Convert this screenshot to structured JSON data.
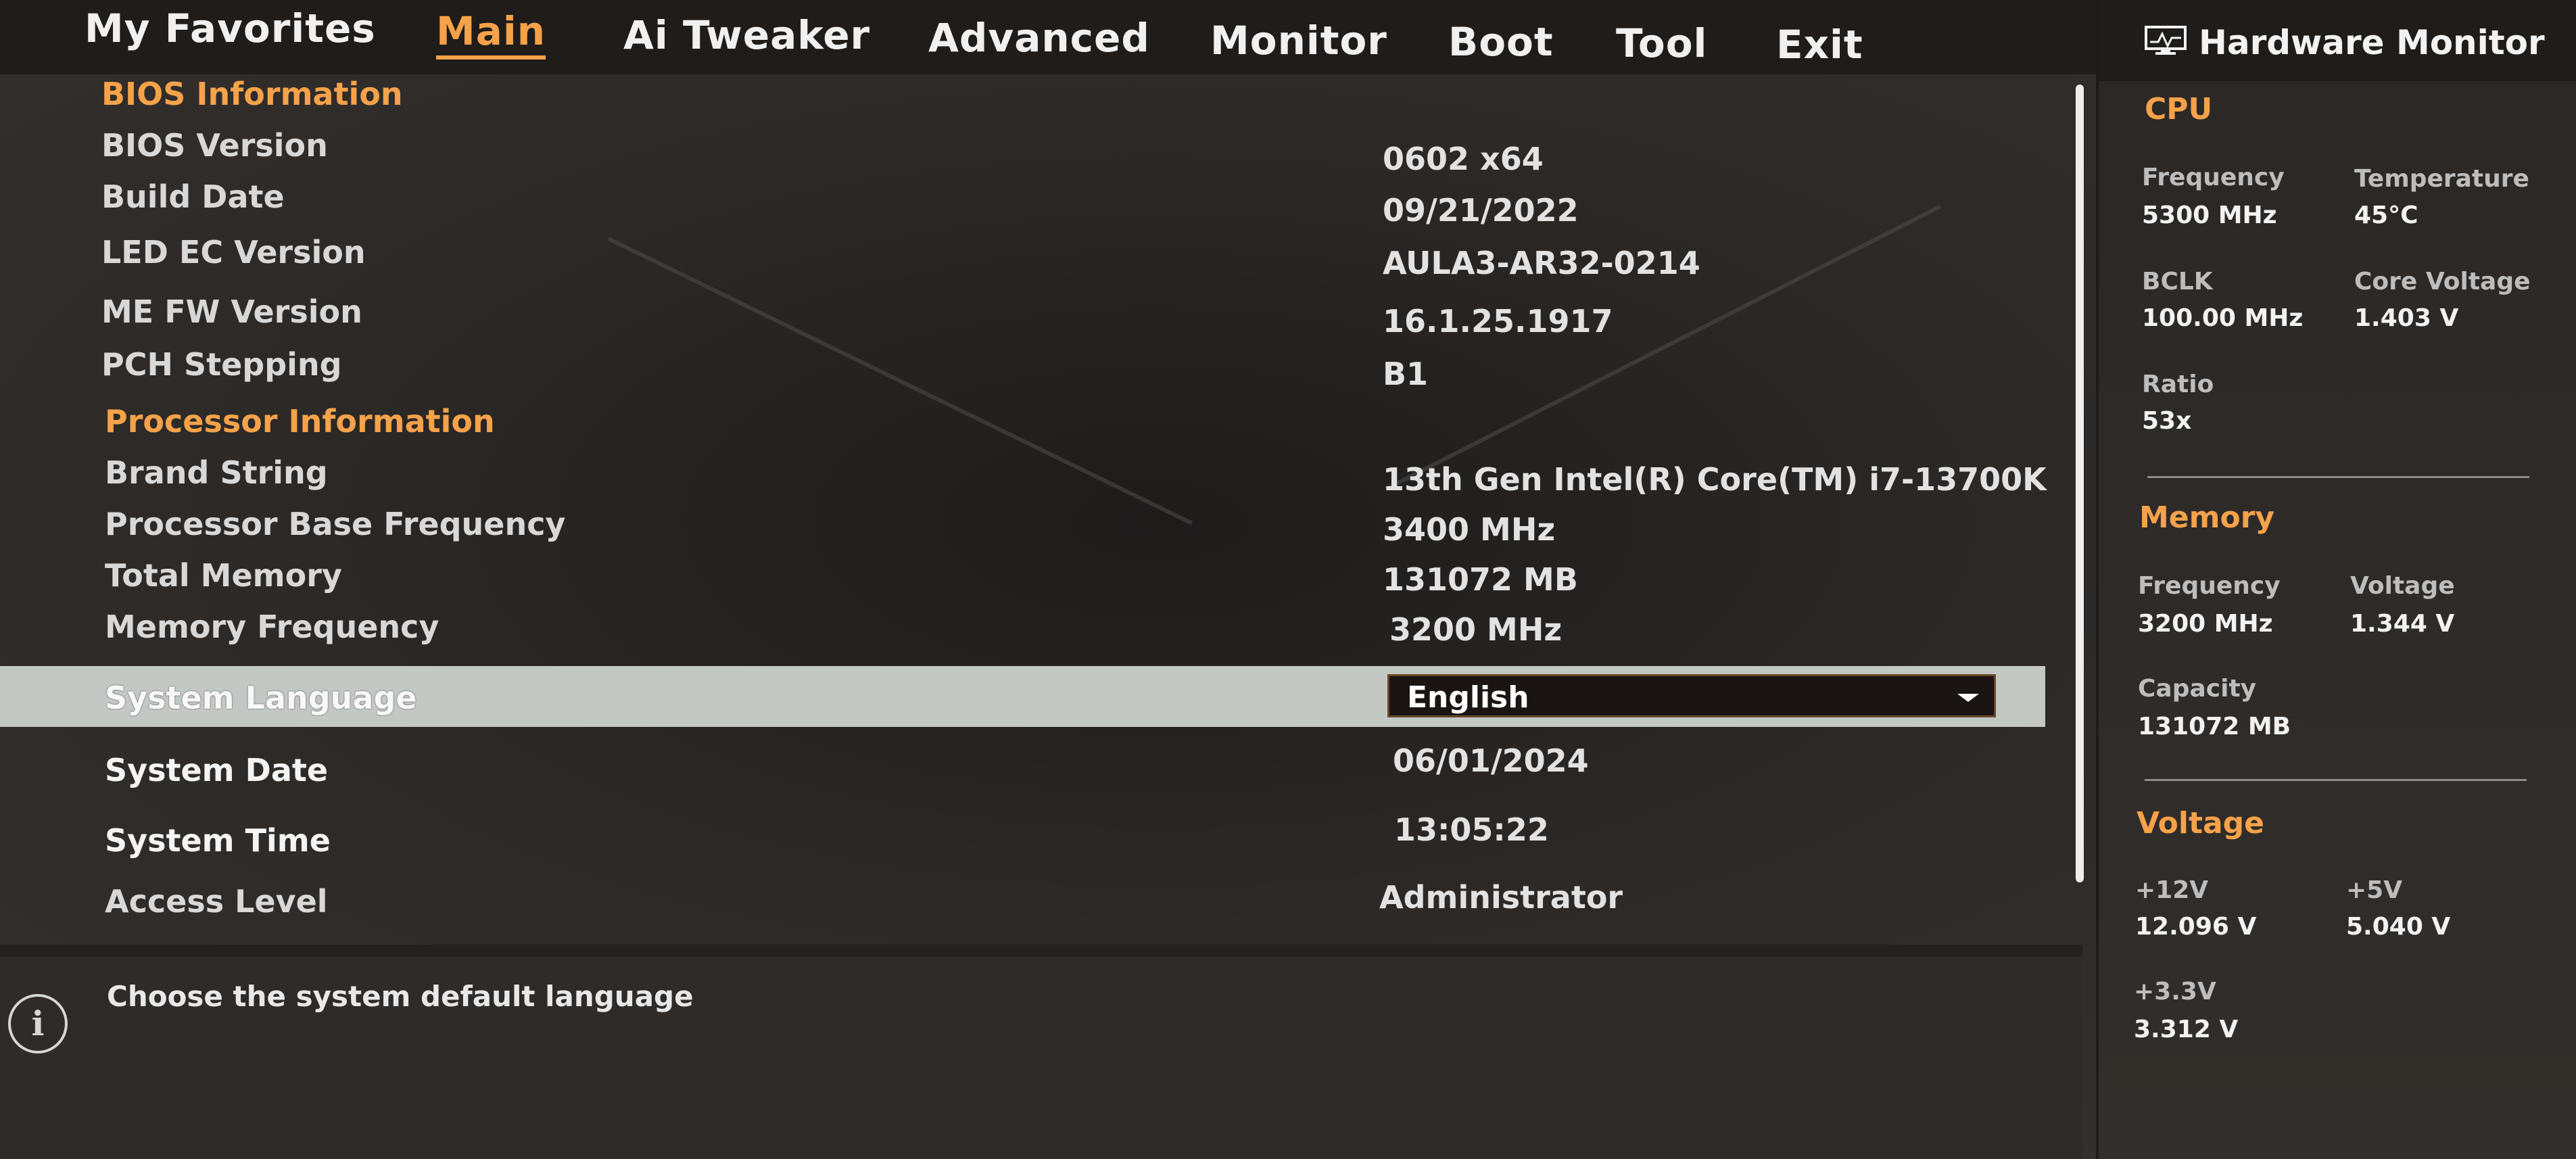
{
  "nav": {
    "items": [
      "My Favorites",
      "Main",
      "Ai Tweaker",
      "Advanced",
      "Monitor",
      "Boot",
      "Tool",
      "Exit"
    ],
    "active": "Main"
  },
  "main": {
    "bios_info": {
      "section": "BIOS Information",
      "rows": [
        {
          "label": "BIOS Version",
          "value": "0602  x64"
        },
        {
          "label": "Build Date",
          "value": "09/21/2022"
        },
        {
          "label": "LED EC Version",
          "value": "AULA3-AR32-0214"
        },
        {
          "label": "ME FW Version",
          "value": "16.1.25.1917"
        },
        {
          "label": "PCH Stepping",
          "value": "B1"
        }
      ]
    },
    "proc_info": {
      "section": "Processor Information",
      "rows": [
        {
          "label": "Brand String",
          "value": "13th Gen Intel(R) Core(TM) i7-13700K"
        },
        {
          "label": "Processor Base Frequency",
          "value": "3400 MHz"
        },
        {
          "label": "Total Memory",
          "value": "131072 MB"
        },
        {
          "label": "Memory Frequency",
          "value": "3200 MHz"
        }
      ]
    },
    "system_language": {
      "label": "System Language",
      "value": "English"
    },
    "system_date": {
      "label": "System Date",
      "value": "06/01/2024"
    },
    "system_time": {
      "label": "System Time",
      "value": "13:05:22"
    },
    "access_level": {
      "label": "Access Level",
      "value": "Administrator"
    }
  },
  "help": {
    "text": "Choose the system default language"
  },
  "hw_monitor": {
    "title": "Hardware Monitor",
    "cpu": {
      "section": "CPU",
      "frequency_label": "Frequency",
      "frequency": "5300 MHz",
      "temperature_label": "Temperature",
      "temperature": "45°C",
      "bclk_label": "BCLK",
      "bclk": "100.00 MHz",
      "core_voltage_label": "Core Voltage",
      "core_voltage": "1.403 V",
      "ratio_label": "Ratio",
      "ratio": "53x"
    },
    "memory": {
      "section": "Memory",
      "frequency_label": "Frequency",
      "frequency": "3200 MHz",
      "voltage_label": "Voltage",
      "voltage": "1.344 V",
      "capacity_label": "Capacity",
      "capacity": "131072 MB"
    },
    "voltage": {
      "section": "Voltage",
      "v12_label": "+12V",
      "v12": "12.096 V",
      "v5_label": "+5V",
      "v5": "5.040 V",
      "v33_label": "+3.3V",
      "v33": "3.312 V"
    }
  },
  "colors": {
    "accent": "#f5a24a",
    "highlight": "#c4c8c5",
    "background": "#2a2725"
  }
}
